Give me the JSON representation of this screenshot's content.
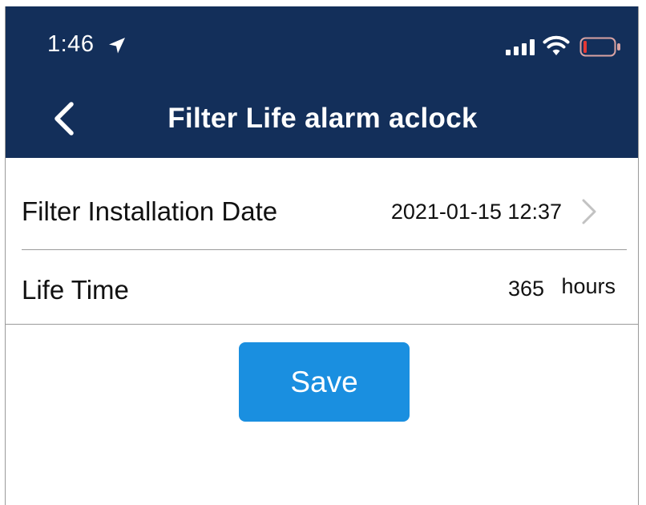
{
  "status_bar": {
    "time": "1:46",
    "icons": [
      "location-arrow-icon",
      "cellular-signal-icon",
      "wifi-icon",
      "battery-low-icon"
    ],
    "battery_level_color": "#e53935"
  },
  "nav": {
    "back_icon": "chevron-left-icon",
    "title": "Filter Life alarm aclock"
  },
  "settings": {
    "installation_date": {
      "label": "Filter Installation Date",
      "value": "2021-01-15 12:37",
      "icon": "chevron-right-icon"
    },
    "life_time": {
      "label": "Life Time",
      "value": "365",
      "unit": "hours"
    }
  },
  "actions": {
    "save_label": "Save"
  },
  "colors": {
    "header_bg": "#132f5a",
    "button_bg": "#1a8fe0"
  }
}
